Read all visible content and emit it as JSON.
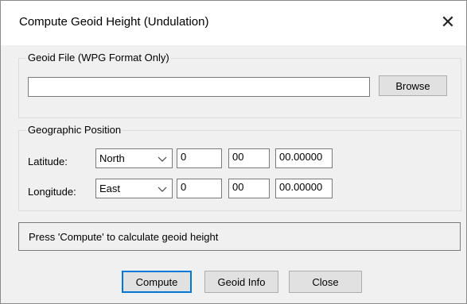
{
  "window": {
    "title": "Compute Geoid Height (Undulation)",
    "close_glyph": "✕"
  },
  "geoid_file": {
    "group_label": "Geoid File (WPG Format Only)",
    "path_value": "",
    "browse_label": "Browse"
  },
  "position": {
    "group_label": "Geographic Position",
    "latitude": {
      "label": "Latitude:",
      "hemisphere": "North",
      "degrees": "0",
      "minutes": "00",
      "seconds": "00.00000"
    },
    "longitude": {
      "label": "Longitude:",
      "hemisphere": "East",
      "degrees": "0",
      "minutes": "00",
      "seconds": "00.00000"
    }
  },
  "status": {
    "message": "Press 'Compute' to calculate geoid height"
  },
  "buttons": {
    "compute": "Compute",
    "geoid_info": "Geoid Info",
    "close": "Close"
  },
  "icons": {
    "close": "close-icon",
    "dropdown": "chevron-down-icon"
  }
}
